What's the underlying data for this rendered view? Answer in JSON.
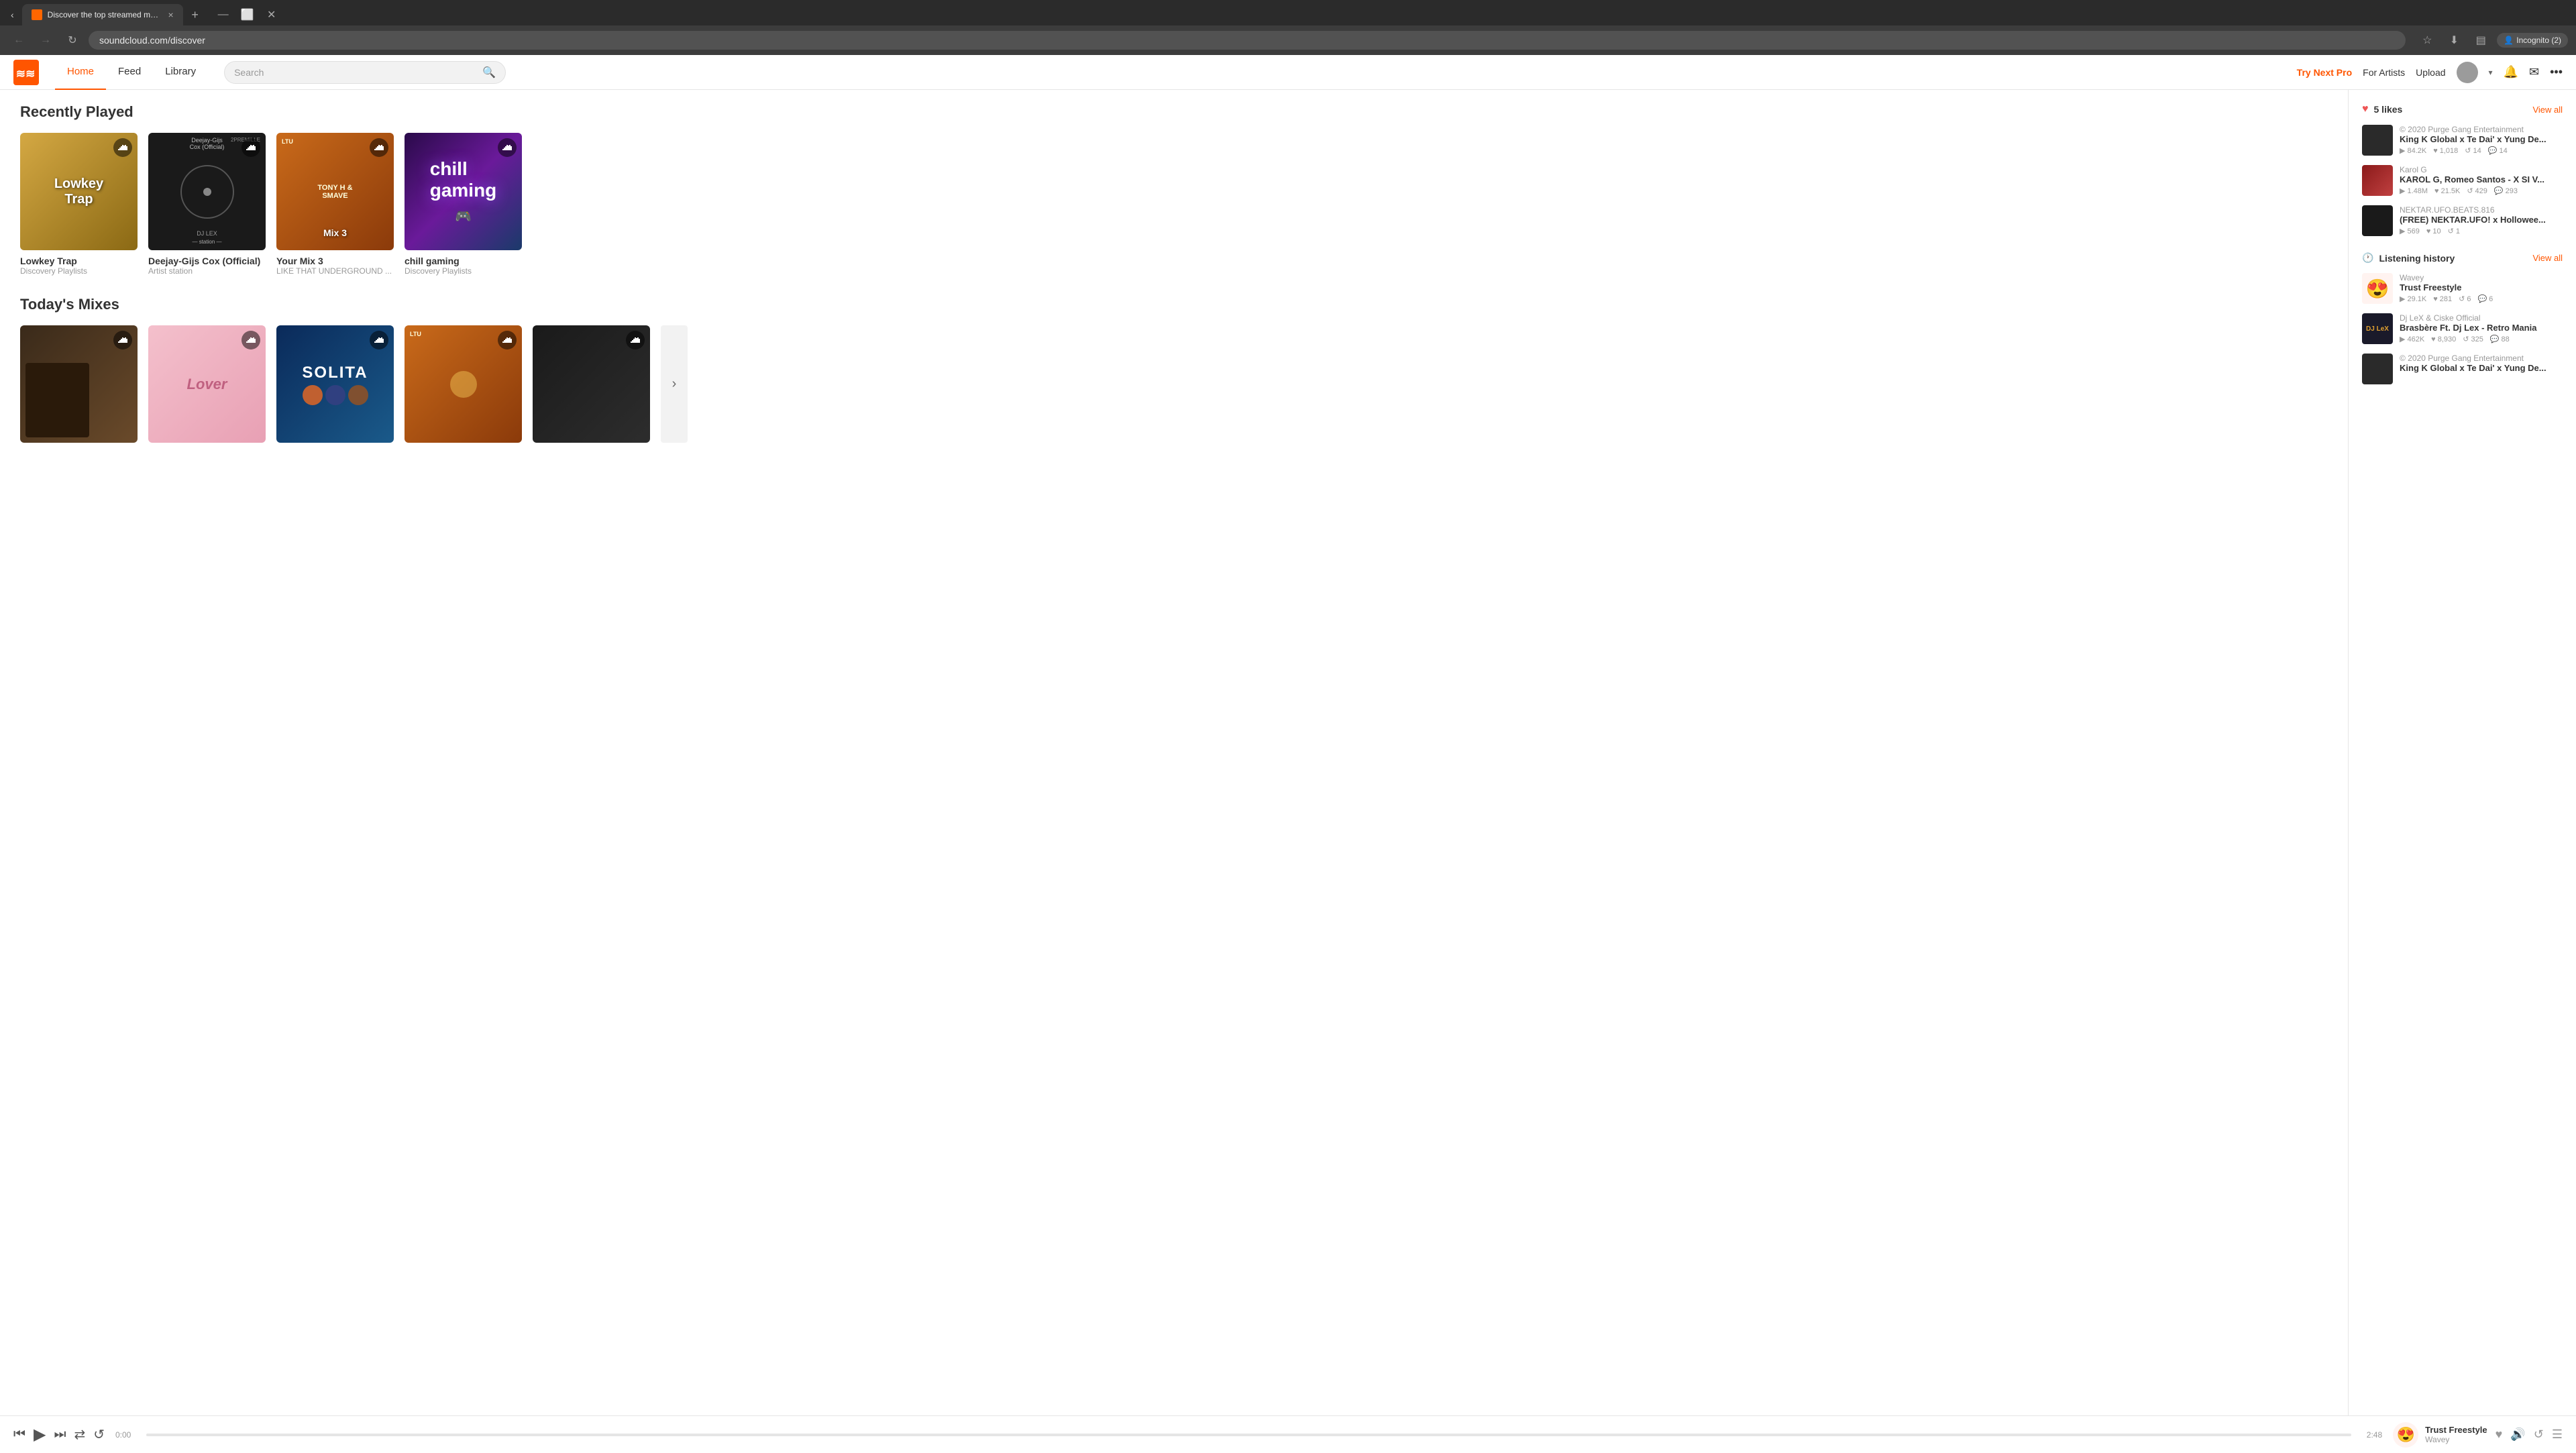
{
  "browser": {
    "tab_title": "Discover the top streamed mus...",
    "tab_close": "×",
    "new_tab": "+",
    "url": "soundcloud.com/discover",
    "back_btn": "←",
    "forward_btn": "→",
    "refresh_btn": "↻",
    "star_btn": "☆",
    "download_btn": "⬇",
    "sidebar_btn": "▤",
    "incognito_label": "Incognito (2)",
    "incognito_icon": "👤",
    "minimize": "—",
    "maximize": "⬜",
    "close": "✕"
  },
  "header": {
    "nav_items": [
      {
        "label": "Home",
        "active": true
      },
      {
        "label": "Feed",
        "active": false
      },
      {
        "label": "Library",
        "active": false
      }
    ],
    "search_placeholder": "Search",
    "try_next_pro": "Try Next Pro",
    "for_artists": "For Artists",
    "upload": "Upload",
    "more_icon": "•••"
  },
  "recently_played": {
    "title": "Recently Played",
    "cards": [
      {
        "name": "Lowkey Trap",
        "sub": "Discovery Playlists",
        "art_type": "lowkey"
      },
      {
        "name": "Deejay-Gijs Cox (Official)",
        "sub": "Artist station",
        "art_type": "deejay"
      },
      {
        "name": "Your Mix 3",
        "sub": "LIKE THAT UNDERGROUND ...",
        "art_type": "mix3"
      },
      {
        "name": "chill gaming",
        "sub": "Discovery Playlists",
        "art_type": "chill"
      }
    ]
  },
  "todays_mixes": {
    "title": "Today's Mixes",
    "cards": [
      {
        "name": "",
        "sub": "",
        "art_type": "art-mix-a"
      },
      {
        "name": "",
        "sub": "",
        "art_type": "art-mix-b"
      },
      {
        "name": "",
        "sub": "",
        "art_type": "art-mix-c"
      },
      {
        "name": "",
        "sub": "",
        "art_type": "art-mix-d"
      },
      {
        "name": "",
        "sub": "",
        "art_type": "art-mix-e"
      }
    ]
  },
  "sidebar": {
    "likes_title": "5 likes",
    "likes_viewall": "View all",
    "history_title": "Listening history",
    "history_viewall": "View all",
    "liked_tracks": [
      {
        "artist": "© 2020 Purge Gang Entertainment",
        "title": "King K Global x Te Dai' x Yung De...",
        "plays": "84.2K",
        "likes": "1,018",
        "reposts": "14",
        "comments": "14",
        "art_type": "art-king"
      },
      {
        "artist": "Karol G",
        "title": "KAROL G, Romeo Santos - X SI V...",
        "plays": "1.48M",
        "likes": "21.5K",
        "reposts": "429",
        "comments": "293",
        "art_type": "art-karol"
      },
      {
        "artist": "NEKTAR.UFO.BEATS.816",
        "title": "(FREE) NEKTAR.UFO! x Hollowee...",
        "plays": "569",
        "likes": "10",
        "reposts": "1",
        "comments": "",
        "art_type": "art-nektar"
      }
    ],
    "history_tracks": [
      {
        "artist": "Wavey",
        "title": "Trust Freestyle",
        "plays": "29.1K",
        "likes": "281",
        "reposts": "6",
        "comments": "6",
        "art_type": "art-wavey",
        "emoji": "😍"
      },
      {
        "artist": "Dj LeX & Ciske Official",
        "title": "Brasbère Ft. Dj Lex - Retro Mania",
        "plays": "462K",
        "likes": "8,930",
        "reposts": "325",
        "comments": "88",
        "art_type": "art-djlex",
        "label": "DJLeX"
      },
      {
        "artist": "© 2020 Purge Gang Entertainment",
        "title": "King K Global x Te Dai' x Yung De...",
        "plays": "",
        "likes": "",
        "reposts": "",
        "comments": "",
        "art_type": "art-king2"
      }
    ]
  },
  "player": {
    "current_time": "0:00",
    "total_time": "2:48",
    "track_name": "Trust Freestyle",
    "artist": "Wavey",
    "emoji": "😍",
    "progress": "0"
  }
}
